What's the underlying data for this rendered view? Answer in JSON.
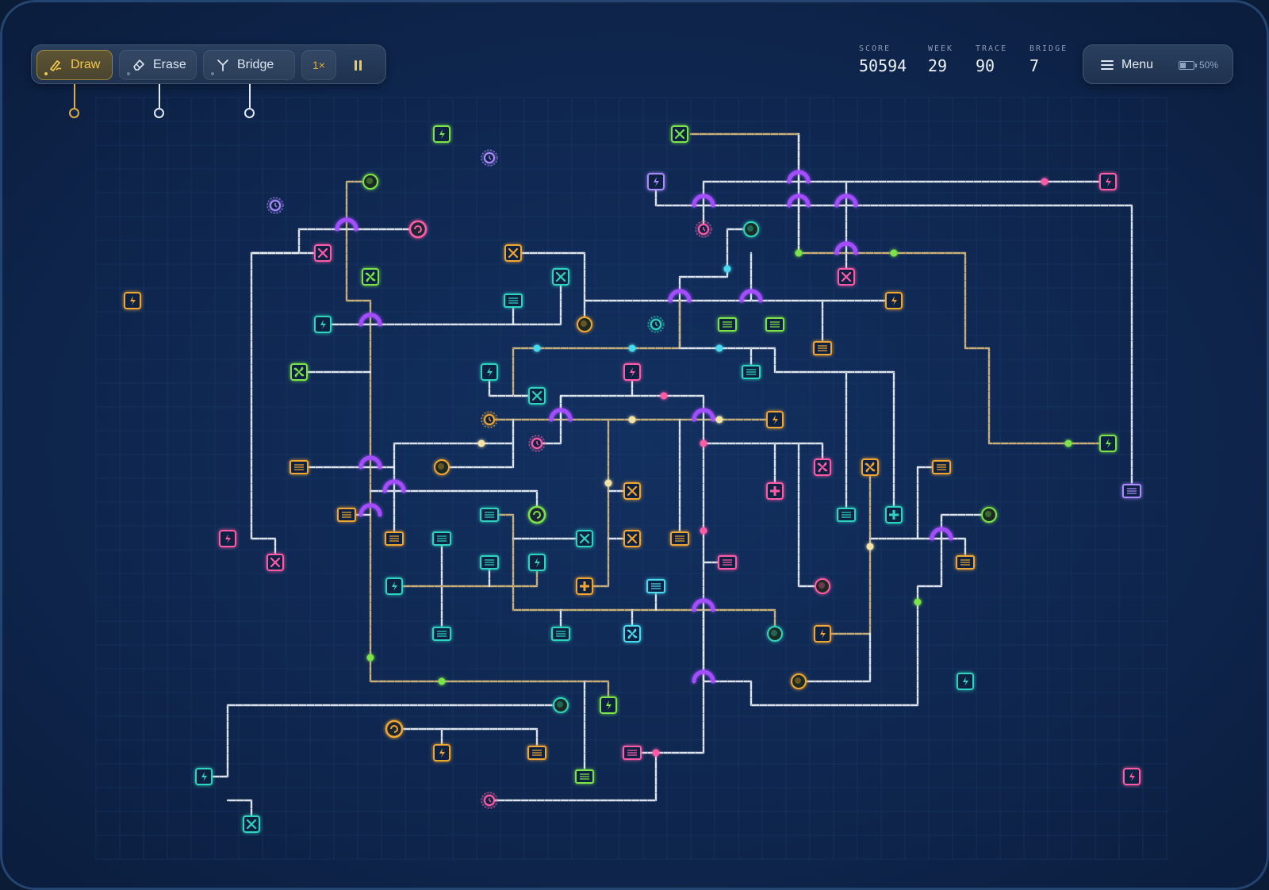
{
  "toolbar": {
    "tools": [
      {
        "id": "draw",
        "label": "Draw",
        "key": "1",
        "icon": "pen-icon",
        "active": true
      },
      {
        "id": "erase",
        "label": "Erase",
        "key": "2",
        "icon": "eraser-icon",
        "active": false
      },
      {
        "id": "bridge",
        "label": "Bridge",
        "key": "3",
        "icon": "bridge-icon",
        "active": false
      }
    ],
    "speed_label": "1×",
    "pause_icon": "pause-icon"
  },
  "stats": [
    {
      "label": "SCORE",
      "value": "50594"
    },
    {
      "label": "WEEK",
      "value": "29"
    },
    {
      "label": "TRACE",
      "value": "90"
    },
    {
      "label": "BRIDGE",
      "value": "7"
    }
  ],
  "menu": {
    "label": "Menu",
    "key": "",
    "battery": "50%",
    "battery_level": 0.5
  },
  "colors": {
    "trace": "#e9eef6",
    "trace_active": "#d2b77d",
    "bridge": "#a34dff",
    "green": "#7be34a",
    "teal": "#2ed4bf",
    "pink": "#ff5ca8",
    "orange": "#f0a630",
    "purple": "#a98aff",
    "cyan": "#4ad9f0"
  }
}
